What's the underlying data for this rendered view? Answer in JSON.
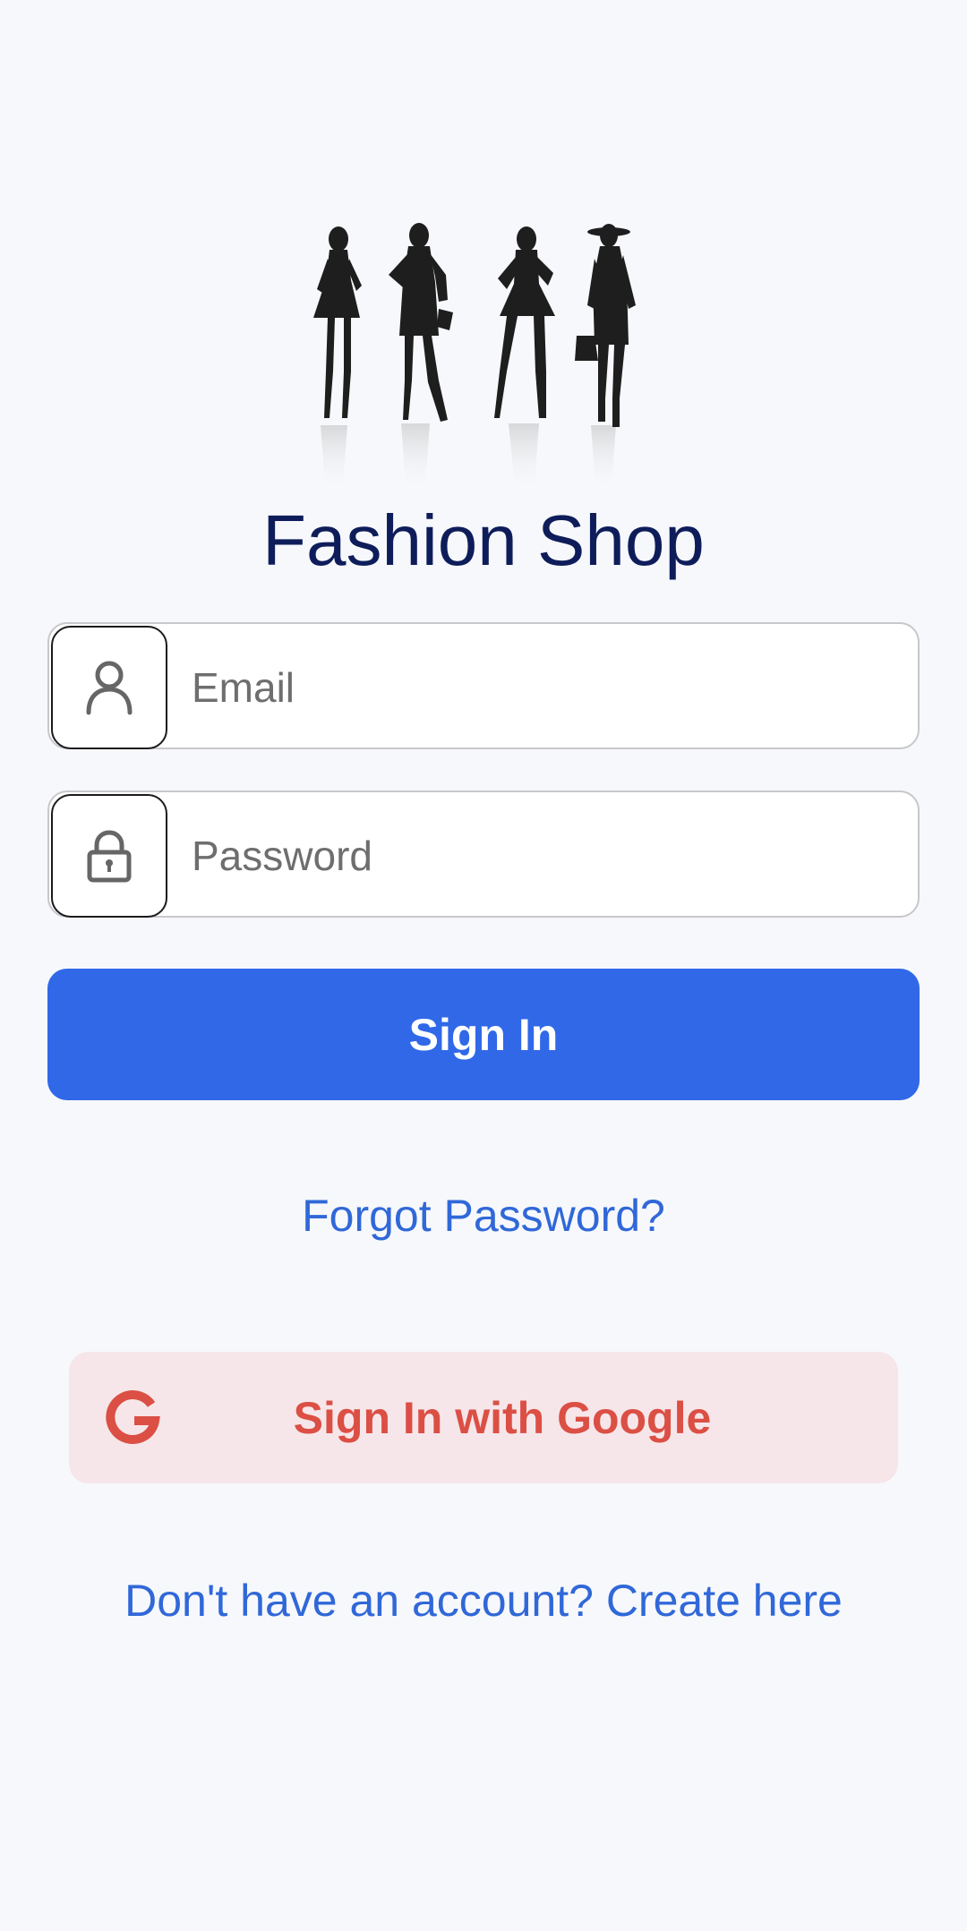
{
  "app": {
    "title": "Fashion Shop",
    "logo_icon": "fashion-silhouettes-logo"
  },
  "form": {
    "email": {
      "placeholder": "Email",
      "value": "",
      "icon": "person-icon"
    },
    "password": {
      "placeholder": "Password",
      "value": "",
      "icon": "lock-icon"
    }
  },
  "actions": {
    "sign_in_label": "Sign In",
    "forgot_password_label": "Forgot Password?",
    "google_sign_in_label": "Sign In with Google",
    "create_account_label": "Don't have an account? Create here"
  },
  "colors": {
    "background": "#f7f8fc",
    "title": "#0e1d5a",
    "primary": "#3068e8",
    "link": "#3068d8",
    "google_bg": "#f6e6e9",
    "google_text": "#db4f44"
  }
}
